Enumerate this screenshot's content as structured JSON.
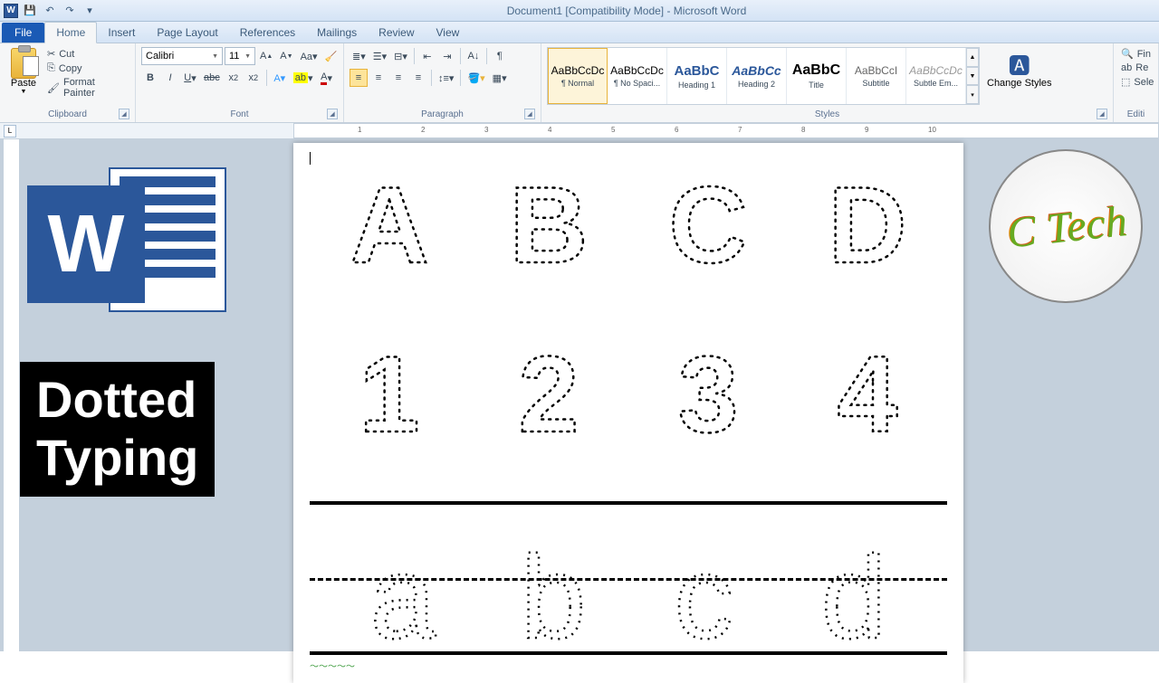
{
  "title": "Document1 [Compatibility Mode] - Microsoft Word",
  "qat": {
    "save": "💾",
    "undo": "↶",
    "redo": "↷"
  },
  "tabs": {
    "file": "File",
    "home": "Home",
    "insert": "Insert",
    "pagelayout": "Page Layout",
    "references": "References",
    "mailings": "Mailings",
    "review": "Review",
    "view": "View"
  },
  "clipboard": {
    "paste": "Paste",
    "cut": "Cut",
    "copy": "Copy",
    "format_painter": "Format Painter",
    "label": "Clipboard"
  },
  "font": {
    "name": "Calibri",
    "size": "11",
    "label": "Font"
  },
  "paragraph": {
    "label": "Paragraph"
  },
  "styles": {
    "label": "Styles",
    "items": [
      {
        "preview": "AaBbCcDc",
        "name": "¶ Normal",
        "active": true
      },
      {
        "preview": "AaBbCcDc",
        "name": "¶ No Spaci..."
      },
      {
        "preview": "AaBbC",
        "name": "Heading 1"
      },
      {
        "preview": "AaBbCc",
        "name": "Heading 2"
      },
      {
        "preview": "AaBbC",
        "name": "Title"
      },
      {
        "preview": "AaBbCcI",
        "name": "Subtitle"
      },
      {
        "preview": "AaBbCcDc",
        "name": "Subtle Em..."
      }
    ],
    "change": "Change Styles"
  },
  "editing": {
    "label": "Editi",
    "find": "Fin",
    "replace": "Re",
    "select": "Sele"
  },
  "ruler": [
    "1",
    "2",
    "3",
    "4",
    "5",
    "6",
    "7",
    "8",
    "9",
    "10"
  ],
  "document": {
    "row1": [
      "A",
      "B",
      "C",
      "D"
    ],
    "row2": [
      "1",
      "2",
      "3",
      "4"
    ],
    "row3": [
      "a",
      "b",
      "c",
      "d"
    ]
  },
  "overlay": {
    "badge_line1": "Dotted",
    "badge_line2": "Typing",
    "ctech": "C Tech",
    "wletter": "W"
  }
}
